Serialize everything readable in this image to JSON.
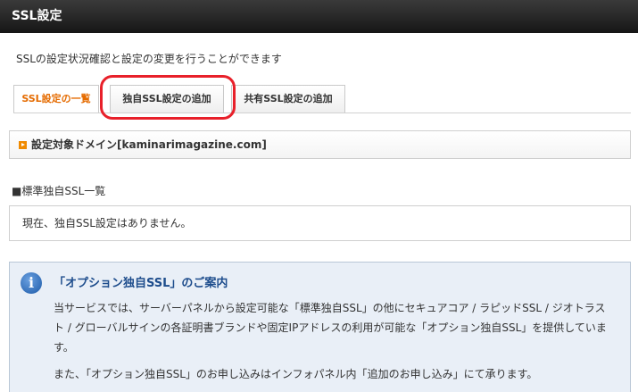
{
  "header": {
    "title": "SSL設定"
  },
  "description": "SSLの設定状況確認と設定の変更を行うことができます",
  "tabs": [
    {
      "label": "SSL設定の一覧",
      "active": true
    },
    {
      "label": "独自SSL設定の追加",
      "active": false,
      "highlighted": true
    },
    {
      "label": "共有SSL設定の追加",
      "active": false
    }
  ],
  "domain_box": {
    "label": "設定対象ドメイン[kaminarimagazine.com]"
  },
  "section": {
    "heading": "■標準独自SSL一覧",
    "empty_message": "現在、独自SSL設定はありません。"
  },
  "info": {
    "icon": "info-icon",
    "title": "「オプション独自SSL」のご案内",
    "paragraph1": "当サービスでは、サーバーパネルから設定可能な「標準独自SSL」の他にセキュアコア / ラピッドSSL / ジオトラスト / グローバルサインの各証明書ブランドや固定IPアドレスの利用が可能な「オプション独自SSL」を提供しています。",
    "paragraph2": "また、「オプション独自SSL」のお申し込みはインフォパネル内「追加のお申し込み」にて承ります。"
  },
  "colors": {
    "accent_orange": "#e56b00",
    "highlight_red": "#e8202a",
    "info_blue": "#1d4c8c"
  }
}
